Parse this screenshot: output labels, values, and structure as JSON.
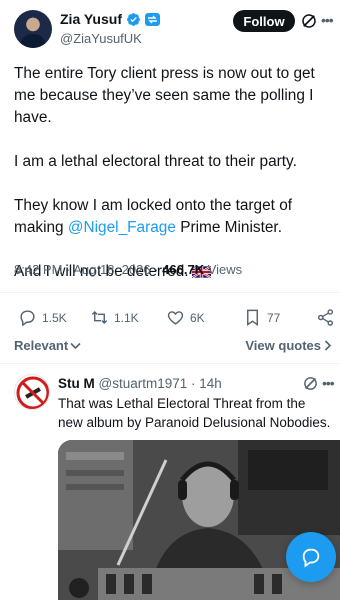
{
  "author": {
    "display_name": "Zia Yusuf",
    "handle": "@ZiaYusufUK",
    "follow_label": "Follow",
    "avatar_icon": "profile-photo"
  },
  "tweet": {
    "p1": "The entire Tory client press is now out to get me because they’ve seen same the polling I have.",
    "p2": "I am a lethal electoral threat to their party.",
    "p3_prefix": "They know I am locked onto the target of making ",
    "p3_mention": "@Nigel_Farage",
    "p3_suffix": " Prime Minister.",
    "p4": "And I will not be deterred.",
    "flag_icon": "uk-flag-emoji"
  },
  "meta": {
    "time_date": "8:42 PM · Aug 18, 2026 · ",
    "views_count": "466.7K",
    "views_label": " Views"
  },
  "actions": {
    "replies": "1.5K",
    "reposts": "1.1K",
    "likes": "6K",
    "bookmarks": "77"
  },
  "sort": {
    "relevant_label": "Relevant",
    "view_quotes_label": "View quotes"
  },
  "reply": {
    "name": "Stu M",
    "handle": "@stuartm1971",
    "time": " · 14h",
    "text": "That was Lethal Electoral Threat from the new album by Paranoid Delusional Nobodies."
  },
  "colors": {
    "accent": "#1d9bf0",
    "text_primary": "#0f1419",
    "text_secondary": "#536471",
    "follow_bg": "#0f1419"
  }
}
